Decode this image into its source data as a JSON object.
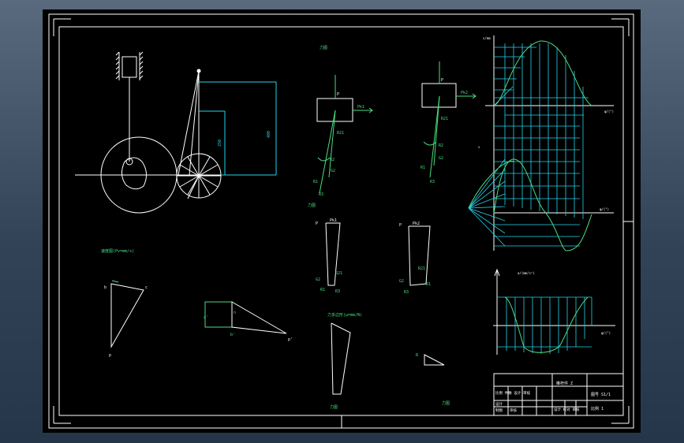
{
  "colors": {
    "viewport_bg": "#3b4d62",
    "sheet": "#000000",
    "white": "#ffffff",
    "cyan": "#22d3ee",
    "green": "#4ade80"
  },
  "labels": {
    "force_right_1": "Pk1",
    "force_right_2": "Pk2",
    "p1": "P",
    "p2": "P",
    "p3": "P",
    "p4": "P",
    "r12": "R12",
    "r21": "R21",
    "g2": "G2",
    "pk3": "Pk1",
    "pk4": "Pk2"
  },
  "title_block": {
    "name": "推杆件 Z",
    "drawing_no": "图号 S1/1",
    "scale": "比例 1",
    "row_mid": "比例 件数 设计 审核",
    "row_bottom": "设计 校对 审核",
    "left_row1": "设计",
    "left_row2": "制图",
    "left_row3": "审核"
  },
  "icons": {
    "cam": "cam-disk-icon",
    "roller": "roller-wheel-icon",
    "guide": "slider-guide-icon"
  }
}
